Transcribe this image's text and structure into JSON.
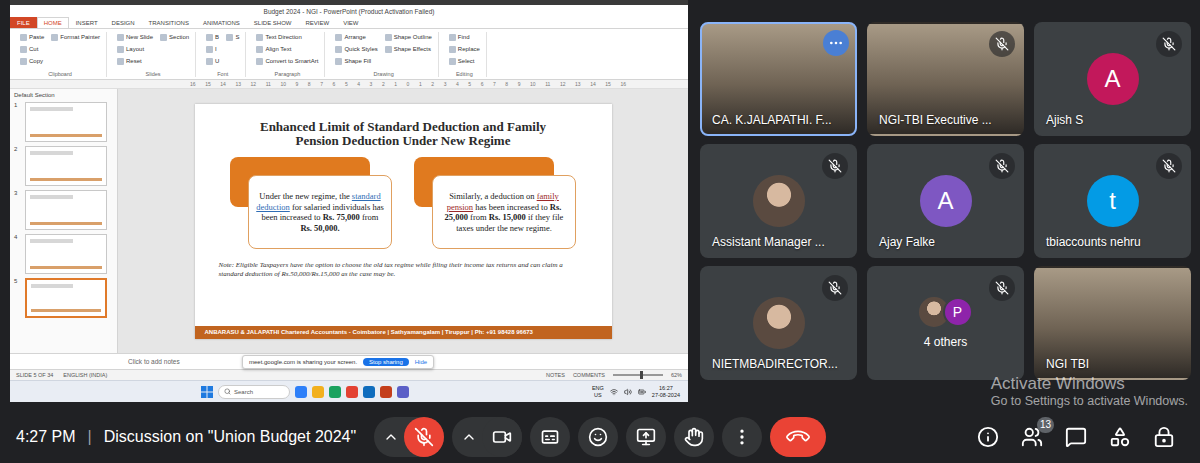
{
  "meeting": {
    "time": "4:27 PM",
    "divider": "|",
    "title": "Discussion on \"Union Budget 2024\""
  },
  "screen": {
    "app_title": "Budget 2024 - NGI - PowerPoint (Product Activation Failed)",
    "ribbon_tabs": [
      {
        "label": "FILE",
        "kind": "file",
        "selected": false
      },
      {
        "label": "HOME",
        "kind": "tab",
        "selected": true
      },
      {
        "label": "INSERT",
        "kind": "tab",
        "selected": false
      },
      {
        "label": "DESIGN",
        "kind": "tab",
        "selected": false
      },
      {
        "label": "TRANSITIONS",
        "kind": "tab",
        "selected": false
      },
      {
        "label": "ANIMATIONS",
        "kind": "tab",
        "selected": false
      },
      {
        "label": "SLIDE SHOW",
        "kind": "tab",
        "selected": false
      },
      {
        "label": "REVIEW",
        "kind": "tab",
        "selected": false
      },
      {
        "label": "VIEW",
        "kind": "tab",
        "selected": false
      }
    ],
    "ribbon_groups": [
      {
        "name": "Clipboard",
        "items": [
          "Paste",
          "Cut",
          "Copy",
          "Format Painter"
        ]
      },
      {
        "name": "Slides",
        "items": [
          "New Slide",
          "Layout",
          "Reset",
          "Section"
        ]
      },
      {
        "name": "Font",
        "items": [
          "B",
          "I",
          "U",
          "S"
        ]
      },
      {
        "name": "Paragraph",
        "items": [
          "Text Direction",
          "Align Text",
          "Convert to SmartArt"
        ]
      },
      {
        "name": "Drawing",
        "items": [
          "Arrange",
          "Quick Styles",
          "Shape Fill",
          "Shape Outline",
          "Shape Effects"
        ]
      },
      {
        "name": "Editing",
        "items": [
          "Find",
          "Replace",
          "Select"
        ]
      }
    ],
    "ruler": [
      "16",
      "15",
      "14",
      "13",
      "12",
      "11",
      "10",
      "9",
      "8",
      "7",
      "6",
      "5",
      "4",
      "3",
      "2",
      "1",
      "0",
      "1",
      "2",
      "3",
      "4",
      "5",
      "6",
      "7",
      "8",
      "9",
      "10",
      "11",
      "12",
      "13",
      "14",
      "15",
      "16"
    ],
    "section": "Default Section",
    "thumbnails": [
      {
        "number": "1",
        "selected": false
      },
      {
        "number": "2",
        "selected": false
      },
      {
        "number": "3",
        "selected": false
      },
      {
        "number": "4",
        "selected": false
      },
      {
        "number": "5",
        "selected": true
      }
    ],
    "slide": {
      "title": "Enhanced Limit of Standard Deduction and Family Pension Deduction Under New Regime",
      "cards": [
        {
          "segments": [
            {
              "text": "Under the new regime, the ",
              "style": "plain"
            },
            {
              "text": "standard deduction",
              "style": "link",
              "color": "#2f6db5"
            },
            {
              "text": " for salaried individuals has been increased to ",
              "style": "plain"
            },
            {
              "text": "Rs. 75,000",
              "style": "bold"
            },
            {
              "text": " from ",
              "style": "plain"
            },
            {
              "text": "Rs. 50,000.",
              "style": "bold"
            }
          ]
        },
        {
          "segments": [
            {
              "text": "Similarly, a deduction on ",
              "style": "plain"
            },
            {
              "text": "family pension",
              "style": "link",
              "color": "#9c2a2a"
            },
            {
              "text": " has been increased to ",
              "style": "plain"
            },
            {
              "text": "Rs. 25,000",
              "style": "bold"
            },
            {
              "text": " from ",
              "style": "plain"
            },
            {
              "text": "Rs. 15,000",
              "style": "bold"
            },
            {
              "text": " if they file taxes under the new regime.",
              "style": "plain"
            }
          ]
        }
      ],
      "note": "Note: Eligible Taxpayers have the option to choose the old tax regime while filing their income tax returns and can claim a standard deduction of Rs.50,000/Rs.15,000 as the case may be.",
      "footer": "ANBARASU & JALAPATHI Chartered Accountants - Coimbatore | Sathyamangalam | Tiruppur | Ph: +91 98428 96673"
    },
    "notes_placeholder": "Click to add notes",
    "share_bar": {
      "message": "meet.google.com is sharing your screen.",
      "stop": "Stop sharing",
      "hide": "Hide"
    },
    "status_bar": {
      "slide": "SLIDE 5 OF 34",
      "language": "ENGLISH (INDIA)",
      "notes": "NOTES",
      "comments": "COMMENTS",
      "zoom": "62%",
      "zoom_level": 0.55
    },
    "taskbar": {
      "search": "Search",
      "language": "ENG",
      "region": "US",
      "time": "16:27",
      "date": "27-08-2024"
    }
  },
  "participants": [
    {
      "name": "CA. K.JALAPATHI. F...",
      "kind": "video",
      "muted": false,
      "speaking": true,
      "hovered": true
    },
    {
      "name": "NGI-TBI Executive ...",
      "kind": "video",
      "muted": true,
      "speaking": false,
      "hovered": false
    },
    {
      "name": "Ajish S",
      "kind": "letter",
      "avatar": "A",
      "color": "#c2185b",
      "muted": true,
      "speaking": false,
      "hovered": false
    },
    {
      "name": "Assistant Manager ...",
      "kind": "photo",
      "muted": true,
      "speaking": false,
      "hovered": false
    },
    {
      "name": "Ajay Falke",
      "kind": "letter",
      "avatar": "A",
      "color": "#7e57c2",
      "muted": true,
      "speaking": false,
      "hovered": false
    },
    {
      "name": "tbiaccounts nehru",
      "kind": "letter",
      "avatar": "t",
      "color": "#039be5",
      "muted": true,
      "speaking": false,
      "hovered": false
    },
    {
      "name": "NIETMBADIRECTOR...",
      "kind": "photo",
      "muted": true,
      "speaking": false,
      "hovered": false
    },
    {
      "name": "4 others",
      "kind": "group",
      "avatar": "P",
      "color": "#8e24aa",
      "muted": true,
      "speaking": false,
      "hovered": false
    },
    {
      "name": "NGI TBI",
      "kind": "video",
      "muted": false,
      "speaking": false,
      "hovered": false
    }
  ],
  "controls": [
    {
      "kind": "mic",
      "muted": true,
      "menu": true
    },
    {
      "kind": "camera",
      "muted": false,
      "menu": true
    },
    {
      "kind": "captions",
      "muted": false,
      "menu": false
    },
    {
      "kind": "emoji",
      "muted": false,
      "menu": false
    },
    {
      "kind": "present",
      "muted": false,
      "menu": false
    },
    {
      "kind": "hand",
      "muted": false,
      "menu": false
    },
    {
      "kind": "more",
      "muted": false,
      "menu": false
    },
    {
      "kind": "leave",
      "muted": false,
      "menu": false
    }
  ],
  "side_controls": [
    {
      "kind": "info",
      "badge": ""
    },
    {
      "kind": "people",
      "badge": "13"
    },
    {
      "kind": "chat",
      "badge": ""
    },
    {
      "kind": "activities",
      "badge": ""
    },
    {
      "kind": "host",
      "badge": ""
    }
  ],
  "watermark": {
    "title": "Activate Windows",
    "subtitle": "Go to Settings to activate Windows."
  }
}
